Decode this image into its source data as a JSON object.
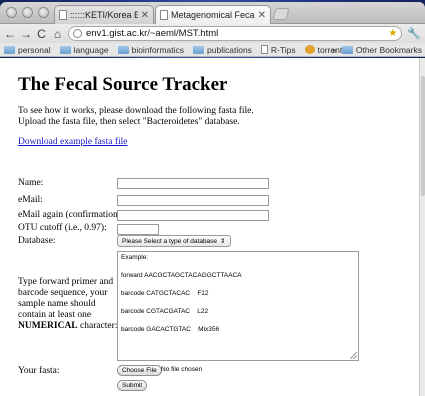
{
  "browser": {
    "tabs": [
      {
        "title": "::::::KETI/Korea Electronics T",
        "active": false
      },
      {
        "title": "Metagenomical Fecal Source",
        "active": true
      }
    ],
    "url": "env1.gist.ac.kr/~aeml/MST.html",
    "bookmarks": [
      {
        "label": "personal",
        "icon": "folder-icon"
      },
      {
        "label": "language",
        "icon": "folder-icon"
      },
      {
        "label": "bioinformatics",
        "icon": "folder-icon"
      },
      {
        "label": "publications",
        "icon": "folder-icon"
      },
      {
        "label": "R-Tips",
        "icon": "page-icon"
      },
      {
        "label": "torrent",
        "icon": "torrent-icon"
      }
    ],
    "bookmarks_overflow": "»",
    "other_bookmarks": "Other Bookmarks"
  },
  "page": {
    "title": "The Fecal Source Tracker",
    "intro_line1": "To see how it works, please download the following fasta file.",
    "intro_line2": "Upload the fasta file, then select \"Bacteroidetes\" database.",
    "download_link": "Download example fasta file",
    "form": {
      "name_label": "Name:",
      "email_label": "eMail:",
      "email_confirm_label": "eMail again (confirmation):",
      "otu_label": "OTU cutoff (i.e., 0.97):",
      "database_label": "Database:",
      "database_selected": "Please Select a type of database",
      "sequence_instructions_pre": "Type forward primer and barcode sequence, your sample name should contain at least one ",
      "sequence_instructions_bold": "NUMERICAL",
      "sequence_instructions_post": " character:",
      "example_lines": [
        "Example:",
        "forward AACGCTAGCTACAGGCTTAACA",
        "barcode CATGCTACAC    F12",
        "barcode CGTACGATAC    L22",
        "barcode GACACTGTAC    Mix356"
      ],
      "fasta_label": "Your fasta:",
      "choose_file_button": "Choose File",
      "no_file_text": "No file chosen",
      "submit_button": "Submit"
    }
  }
}
